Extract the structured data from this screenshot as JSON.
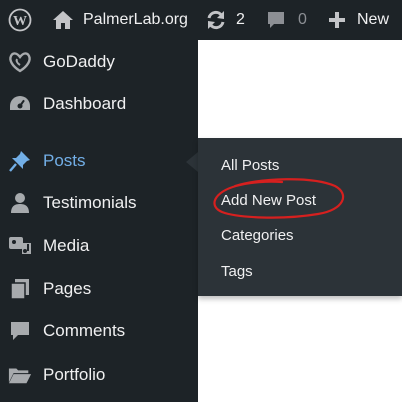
{
  "adminbar": {
    "site_name": "PalmerLab.org",
    "updates_count": "2",
    "comments_count": "0",
    "new_label": "New"
  },
  "sidebar": {
    "items": [
      {
        "label": "GoDaddy",
        "icon": "godaddy-icon"
      },
      {
        "label": "Dashboard",
        "icon": "dashboard-icon"
      },
      {
        "label": "Posts",
        "icon": "pushpin-icon",
        "active": true
      },
      {
        "label": "Testimonials",
        "icon": "person-icon"
      },
      {
        "label": "Media",
        "icon": "media-icon"
      },
      {
        "label": "Pages",
        "icon": "pages-icon"
      },
      {
        "label": "Comments",
        "icon": "comment-icon"
      },
      {
        "label": "Portfolio",
        "icon": "folder-icon"
      }
    ]
  },
  "submenu": {
    "items": [
      {
        "label": "All Posts"
      },
      {
        "label": "Add New Post",
        "highlighted": true
      },
      {
        "label": "Categories"
      },
      {
        "label": "Tags"
      }
    ]
  },
  "colors": {
    "adminbar_bg": "#1d2327",
    "sidebar_bg": "#1d2327",
    "flyout_bg": "#2c3338",
    "active_text": "#72aee6",
    "text": "#f0f0f1",
    "muted": "#8c8f94",
    "annotation_red": "#d6201f"
  }
}
